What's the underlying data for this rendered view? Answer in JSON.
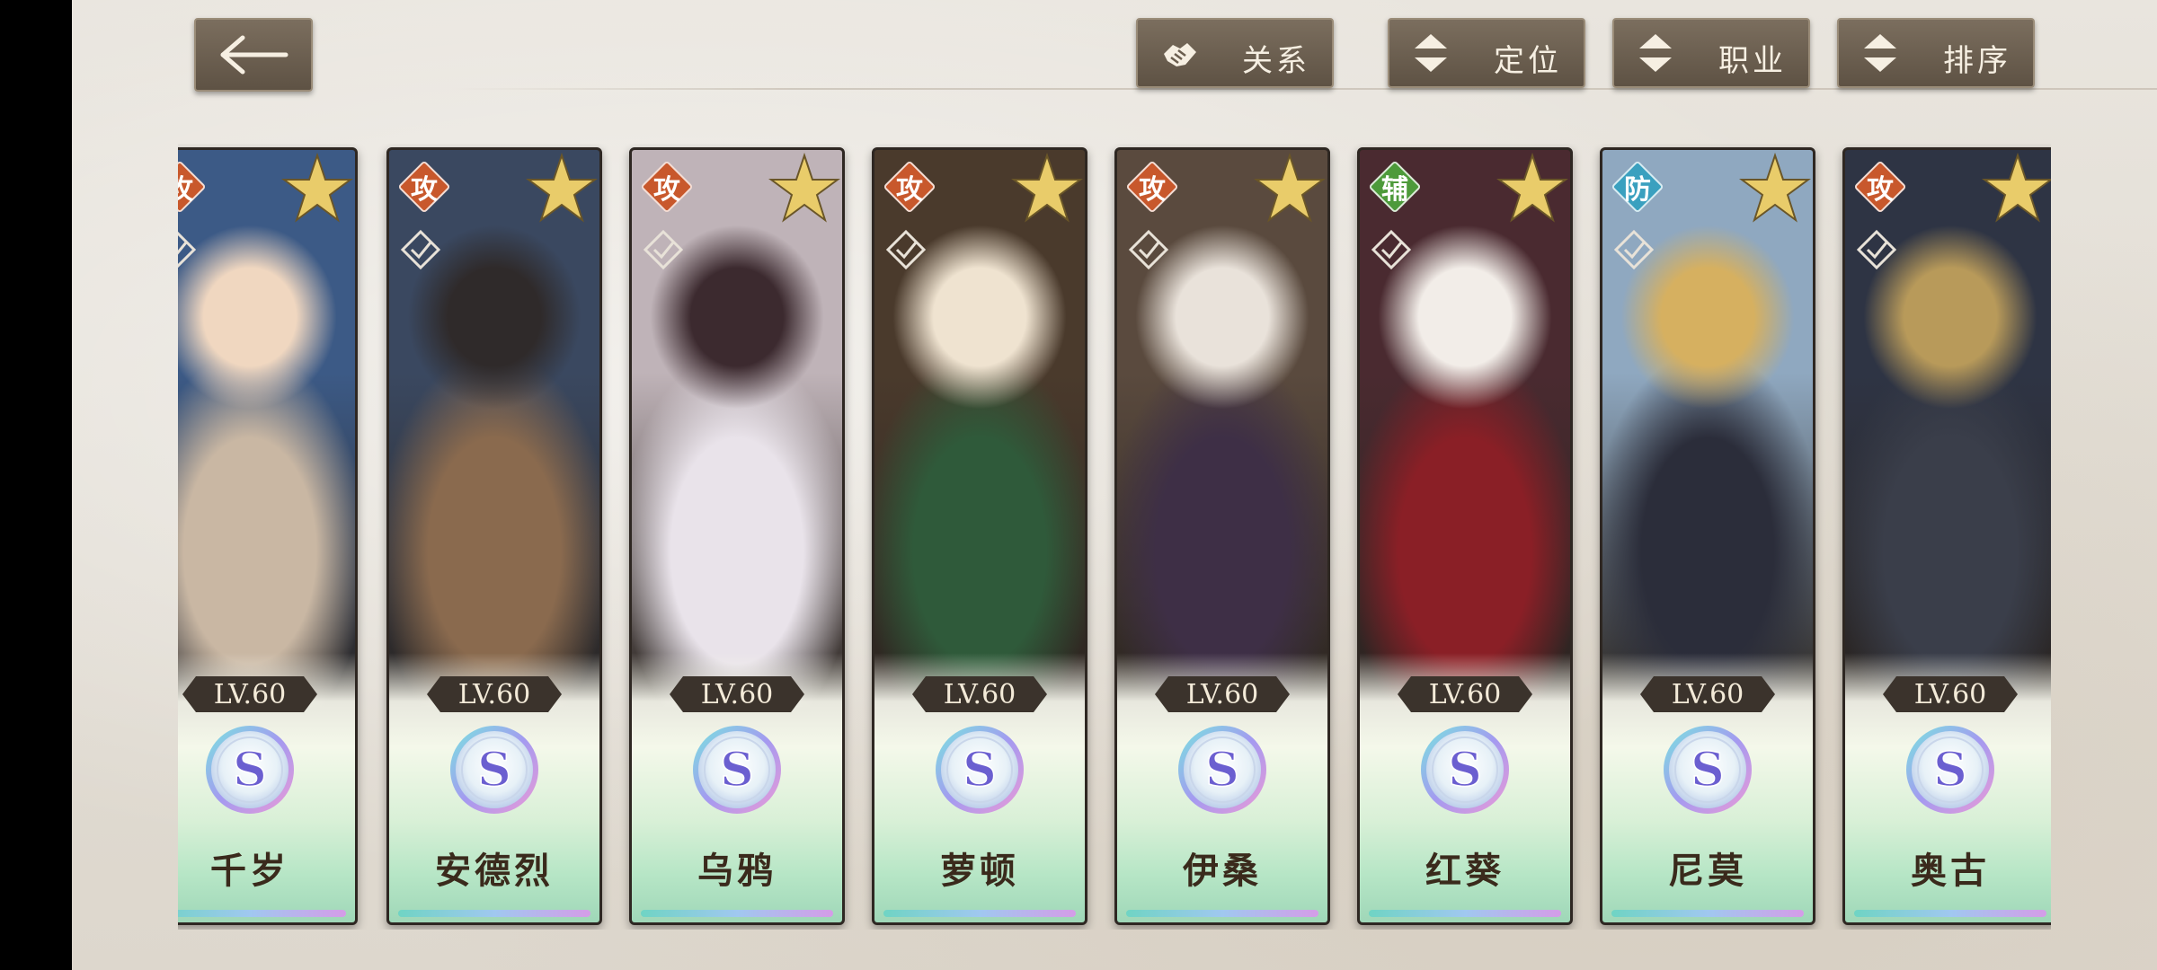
{
  "toolbar": {
    "relation_label": "关系",
    "position_label": "定位",
    "class_label": "职业",
    "sort_label": "排序"
  },
  "colors": {
    "button_bg": "#6b5e4e",
    "attack_tag": "#c8582c",
    "support_tag": "#4d9a3a",
    "defense_tag": "#3aa0bf",
    "star_gold": "#e9cc6a",
    "name_text": "#3a2a1c"
  },
  "heroes": [
    {
      "name": "千岁",
      "level": "LV.60",
      "role": "攻",
      "role_type": "attack",
      "rank": "S",
      "palette": [
        "#3c5a86",
        "#c9b7a3",
        "#f0d7c0"
      ]
    },
    {
      "name": "安德烈",
      "level": "LV.60",
      "role": "攻",
      "role_type": "attack",
      "rank": "S",
      "palette": [
        "#3a4860",
        "#8a6a4e",
        "#2f2a2a"
      ]
    },
    {
      "name": "乌鸦",
      "level": "LV.60",
      "role": "攻",
      "role_type": "attack",
      "rank": "S",
      "palette": [
        "#bfb3b8",
        "#e9e3ea",
        "#3c2a2f"
      ]
    },
    {
      "name": "萝顿",
      "level": "LV.60",
      "role": "攻",
      "role_type": "attack",
      "rank": "S",
      "palette": [
        "#4a3a2c",
        "#2f5a3a",
        "#efe3d0"
      ]
    },
    {
      "name": "伊桑",
      "level": "LV.60",
      "role": "攻",
      "role_type": "attack",
      "rank": "S",
      "palette": [
        "#5a4a3e",
        "#3e2f46",
        "#e9e2da"
      ]
    },
    {
      "name": "红葵",
      "level": "LV.60",
      "role": "辅",
      "role_type": "support",
      "rank": "S",
      "palette": [
        "#4a2a30",
        "#8a1f26",
        "#f2ede8"
      ]
    },
    {
      "name": "尼莫",
      "level": "LV.60",
      "role": "防",
      "role_type": "defense",
      "rank": "S",
      "palette": [
        "#8fa8c0",
        "#2b2d3a",
        "#d6b060"
      ]
    },
    {
      "name": "奥古",
      "level": "LV.60",
      "role": "攻",
      "role_type": "attack",
      "rank": "S",
      "palette": [
        "#2e3444",
        "#3a3e4a",
        "#b89a5a"
      ]
    }
  ]
}
